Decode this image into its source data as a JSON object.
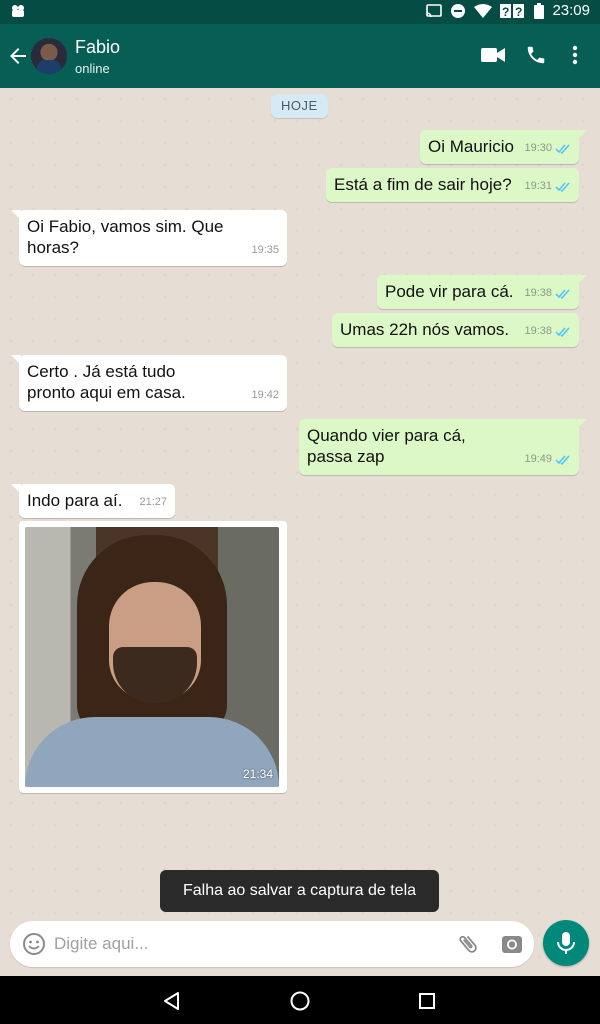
{
  "status_bar": {
    "time": "23:09"
  },
  "header": {
    "contact_name": "Fabio",
    "contact_status": "online"
  },
  "date_divider": "HOJE",
  "messages": [
    {
      "direction": "out",
      "text": "Oi Mauricio",
      "time": "19:30",
      "read": true
    },
    {
      "direction": "out",
      "text": "Está a fim de sair hoje?",
      "time": "19:31",
      "read": true
    },
    {
      "direction": "in",
      "text": "Oi Fabio, vamos sim. Que horas?",
      "time": "19:35"
    },
    {
      "direction": "out",
      "text": "Pode vir para cá.",
      "time": "19:38",
      "read": true
    },
    {
      "direction": "out",
      "text": "Umas 22h nós vamos.",
      "time": "19:38",
      "read": true
    },
    {
      "direction": "in",
      "text": "Certo . Já está tudo pronto aqui em casa.",
      "time": "19:42"
    },
    {
      "direction": "out",
      "text": "Quando vier para cá, passa zap",
      "time": "19:49",
      "read": true
    },
    {
      "direction": "in",
      "text": "Indo para aí.",
      "time": "21:27"
    },
    {
      "direction": "in",
      "type": "photo",
      "time": "21:34"
    }
  ],
  "toast": "Falha ao salvar a captura de tela",
  "composer": {
    "placeholder": "Digite aqui..."
  },
  "colors": {
    "header": "#075e54",
    "status_bar": "#054d44",
    "outgoing_bubble": "#dcf8c6",
    "incoming_bubble": "#ffffff",
    "mic_button": "#00897b",
    "read_ticks": "#4fc3f7"
  },
  "icons": [
    "back-arrow-icon",
    "video-call-icon",
    "phone-icon",
    "more-vert-icon",
    "emoji-icon",
    "attach-icon",
    "camera-icon",
    "mic-icon",
    "nav-back-icon",
    "nav-home-icon",
    "nav-recents-icon"
  ]
}
